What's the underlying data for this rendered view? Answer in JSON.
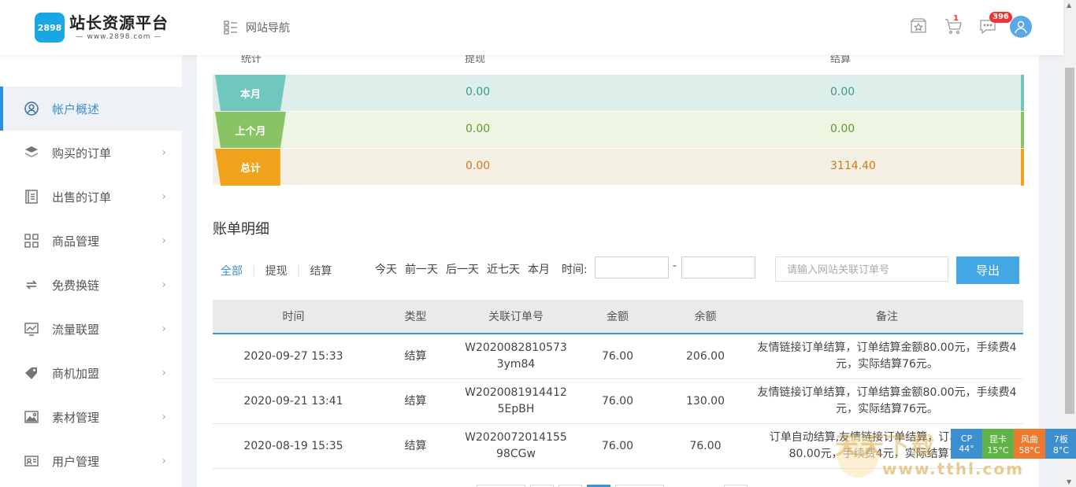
{
  "header": {
    "logo_badge": "2898",
    "logo_title": "站长资源平台",
    "logo_sub": "— www.2898.com —",
    "nav_label": "网站导航",
    "cart_count": "1",
    "msg_count": "396"
  },
  "sidebar": {
    "items": [
      {
        "label": "帐户概述",
        "icon": "user-circle-icon",
        "active": true
      },
      {
        "label": "购买的订单",
        "icon": "layers-icon"
      },
      {
        "label": "出售的订单",
        "icon": "document-icon"
      },
      {
        "label": "商品管理",
        "icon": "grid-icon"
      },
      {
        "label": "免费换链",
        "icon": "exchange-icon"
      },
      {
        "label": "流量联盟",
        "icon": "chart-monitor-icon"
      },
      {
        "label": "商机加盟",
        "icon": "tag-icon"
      },
      {
        "label": "素材管理",
        "icon": "image-icon"
      },
      {
        "label": "用户管理",
        "icon": "id-card-icon"
      }
    ]
  },
  "stats": {
    "head": {
      "c0": "统计",
      "c1": "提现",
      "c2": "结算"
    },
    "rows": [
      {
        "label": "本月",
        "withdraw": "0.00",
        "settle": "0.00",
        "color": "#6fc7be",
        "bg": "#deeeeb",
        "text": "#3a9a8f"
      },
      {
        "label": "上个月",
        "withdraw": "0.00",
        "settle": "0.00",
        "color": "#88c463",
        "bg": "#eef5e3",
        "text": "#5e9a2e"
      },
      {
        "label": "总计",
        "withdraw": "0.00",
        "settle": "3114.40",
        "color": "#f0a21a",
        "bg": "#f3efe3",
        "text": "#d0781c"
      }
    ]
  },
  "detail": {
    "title": "账单明细",
    "tabs": [
      "全部",
      "提现",
      "结算"
    ],
    "ranges": [
      "今天",
      "前一天",
      "后一天",
      "近七天",
      "本月"
    ],
    "time_label": "时间:",
    "dash": "-",
    "search_placeholder": "请输入网站关联订单号",
    "export_label": "导出",
    "columns": [
      "时间",
      "类型",
      "关联订单号",
      "金额",
      "余额",
      "备注"
    ],
    "rows": [
      [
        "2020-09-27 15:33",
        "结算",
        "W20200828105733ym84",
        "76.00",
        "206.00",
        "友情链接订单结算，订单结算金额80.00元，手续费4元，实际结算76元。"
      ],
      [
        "2020-09-21 13:41",
        "结算",
        "W20200819144125EpBH",
        "76.00",
        "130.00",
        "友情链接订单结算，订单结算金额80.00元，手续费4元，实际结算76元。"
      ],
      [
        "2020-08-19 15:35",
        "结算",
        "W202007201415598CGw",
        "76.00",
        "76.00",
        "订单自动结算,友情链接订单结算，订单结算金额80.00元，手续费4元，实际结算76元。"
      ]
    ]
  },
  "weather": [
    {
      "t": "CP",
      "v": "44°",
      "color": "#3d8fd0"
    },
    {
      "t": "昆卡",
      "v": "15°C",
      "color": "#60b347"
    },
    {
      "t": "风曲",
      "v": "58°C",
      "color": "#ee7a2f"
    },
    {
      "t": "7板",
      "v": "8°C",
      "color": "#3d8fd0"
    }
  ],
  "watermark": {
    "main": "天天下载",
    "sub": "www.tthl.com"
  }
}
